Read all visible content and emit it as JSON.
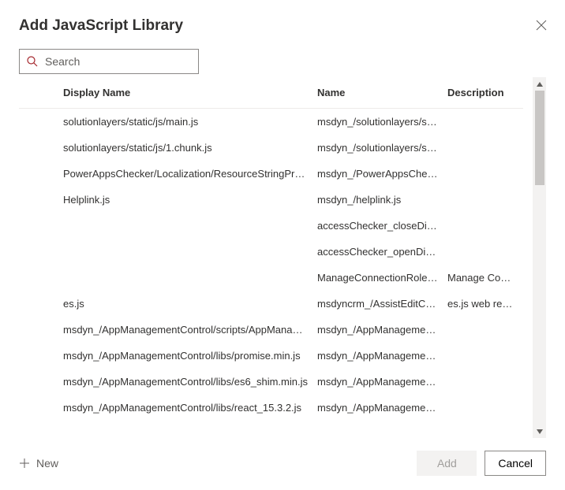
{
  "dialog": {
    "title": "Add JavaScript Library"
  },
  "search": {
    "placeholder": "Search"
  },
  "columns": {
    "displayName": "Display Name",
    "name": "Name",
    "description": "Description"
  },
  "rows": [
    {
      "displayName": "solutionlayers/static/js/main.js",
      "name": "msdyn_/solutionlayers/sta...",
      "description": ""
    },
    {
      "displayName": "solutionlayers/static/js/1.chunk.js",
      "name": "msdyn_/solutionlayers/sta...",
      "description": ""
    },
    {
      "displayName": "PowerAppsChecker/Localization/ResourceStringProvid...",
      "name": "msdyn_/PowerAppsCheck...",
      "description": ""
    },
    {
      "displayName": "Helplink.js",
      "name": "msdyn_/helplink.js",
      "description": ""
    },
    {
      "displayName": "",
      "name": "accessChecker_closeDialo...",
      "description": ""
    },
    {
      "displayName": "",
      "name": "accessChecker_openDialo...",
      "description": ""
    },
    {
      "displayName": "",
      "name": "ManageConnectionRoles....",
      "description": "Manage Connect..."
    },
    {
      "displayName": "es.js",
      "name": "msdyncrm_/AssistEditCon...",
      "description": "es.js web resource."
    },
    {
      "displayName": "msdyn_/AppManagementControl/scripts/AppManage...",
      "name": "msdyn_/AppManagement...",
      "description": ""
    },
    {
      "displayName": "msdyn_/AppManagementControl/libs/promise.min.js",
      "name": "msdyn_/AppManagement...",
      "description": ""
    },
    {
      "displayName": "msdyn_/AppManagementControl/libs/es6_shim.min.js",
      "name": "msdyn_/AppManagement...",
      "description": ""
    },
    {
      "displayName": "msdyn_/AppManagementControl/libs/react_15.3.2.js",
      "name": "msdyn_/AppManagement...",
      "description": ""
    }
  ],
  "footer": {
    "newLabel": "New",
    "addLabel": "Add",
    "cancelLabel": "Cancel"
  }
}
